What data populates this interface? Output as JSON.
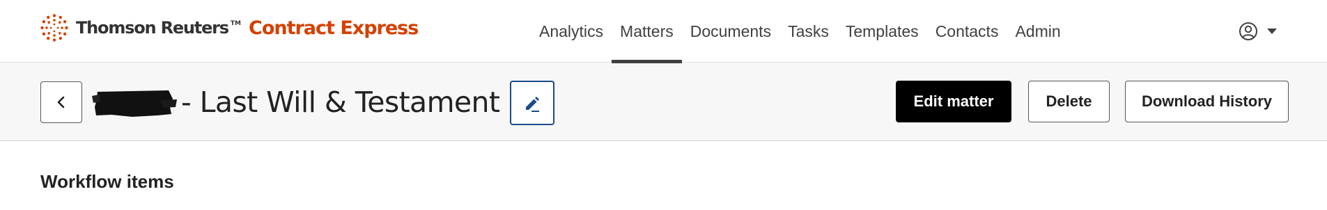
{
  "brand": {
    "company": "Thomson Reuters",
    "trademark": "TM",
    "product": "Contract Express",
    "product_color": "#d64000"
  },
  "nav": {
    "items": [
      {
        "label": "Analytics",
        "active": false
      },
      {
        "label": "Matters",
        "active": true
      },
      {
        "label": "Documents",
        "active": false
      },
      {
        "label": "Tasks",
        "active": false
      },
      {
        "label": "Templates",
        "active": false
      },
      {
        "label": "Contacts",
        "active": false
      },
      {
        "label": "Admin",
        "active": false
      }
    ]
  },
  "user_menu": {
    "icon": "user-circle-icon",
    "caret_icon": "caret-down-icon"
  },
  "matter": {
    "back_icon": "chevron-left-icon",
    "title": "- Last Will & Testament",
    "edit_title_icon": "pencil-icon",
    "edit_icon_color": "#1a4a8c"
  },
  "actions": {
    "edit_matter": "Edit matter",
    "delete": "Delete",
    "download_history": "Download History"
  },
  "workflow": {
    "title": "Workflow items"
  }
}
